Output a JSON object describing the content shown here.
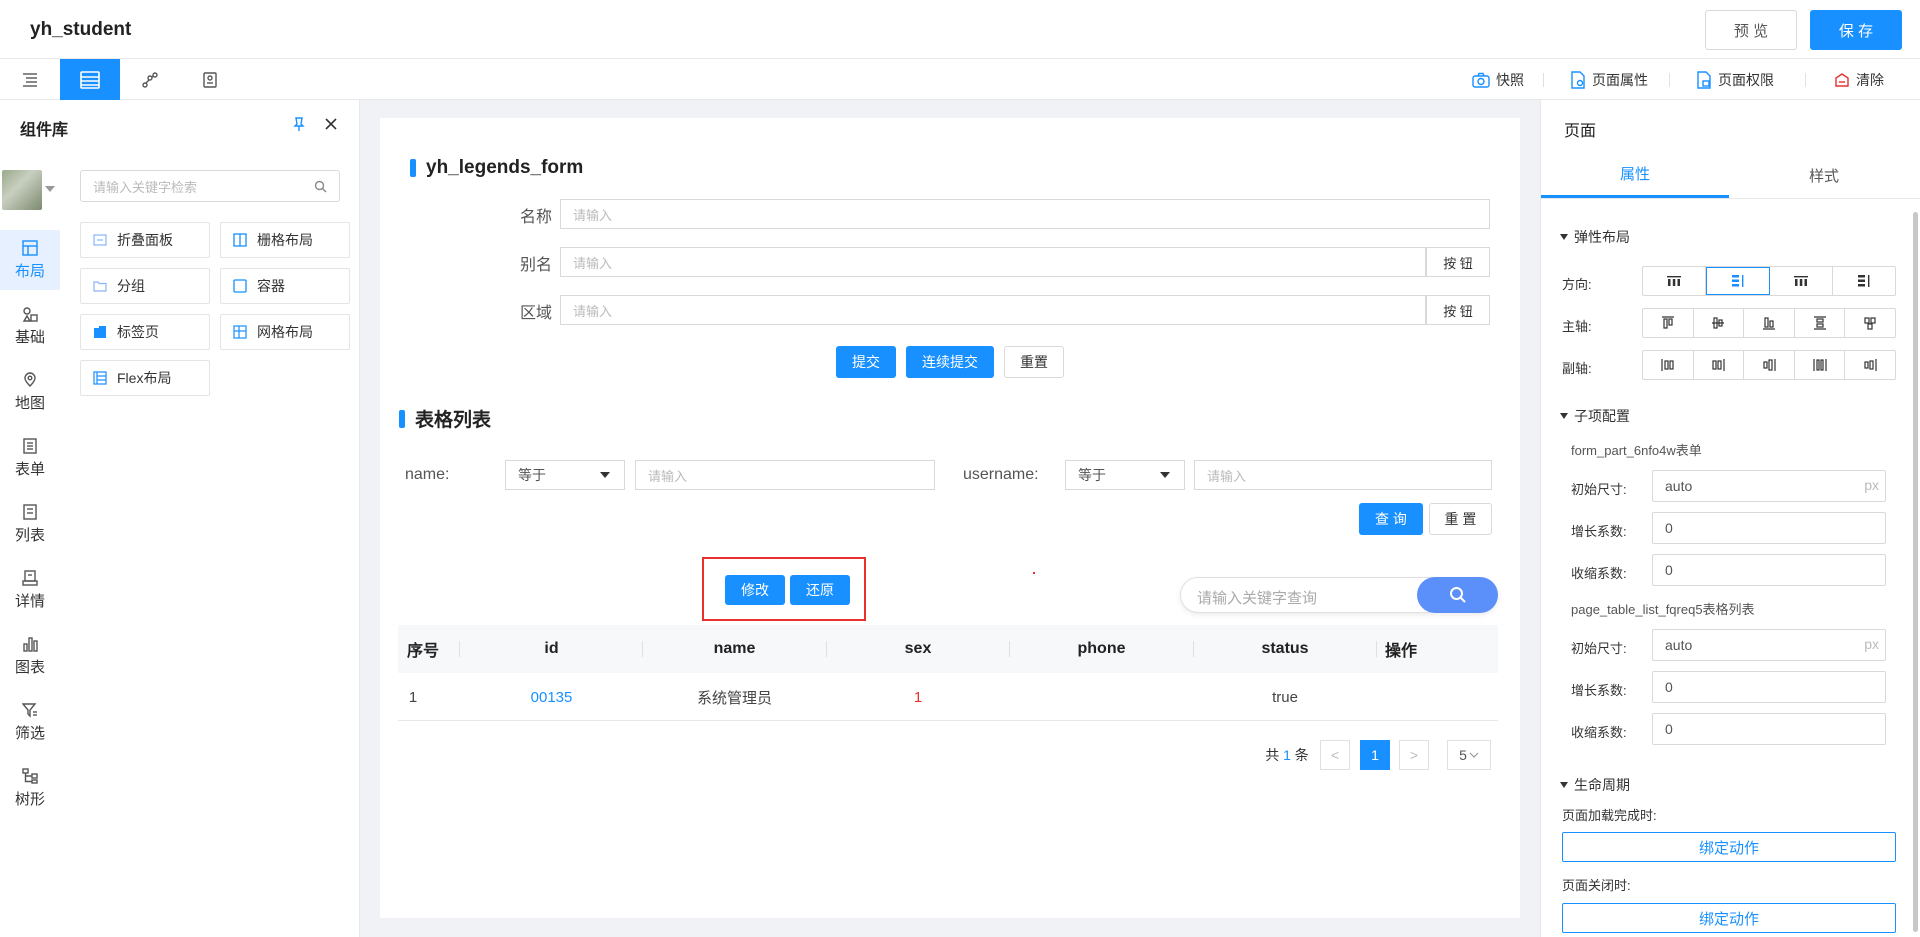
{
  "header": {
    "app_title": "yh_student",
    "preview_label": "预 览",
    "save_label": "保 存"
  },
  "toolbar": {
    "snapshot": "快照",
    "page_props": "页面属性",
    "page_perms": "页面权限",
    "clear": "清除"
  },
  "library": {
    "title": "组件库",
    "search_placeholder": "请输入关键字检索",
    "nav": [
      {
        "label": "布局"
      },
      {
        "label": "基础"
      },
      {
        "label": "地图"
      },
      {
        "label": "表单"
      },
      {
        "label": "列表"
      },
      {
        "label": "详情"
      },
      {
        "label": "图表"
      },
      {
        "label": "筛选"
      },
      {
        "label": "树形"
      }
    ],
    "components": [
      {
        "label": "折叠面板"
      },
      {
        "label": "栅格布局"
      },
      {
        "label": "分组"
      },
      {
        "label": "容器"
      },
      {
        "label": "标签页"
      },
      {
        "label": "网格布局"
      },
      {
        "label": "Flex布局"
      }
    ]
  },
  "form": {
    "title": "yh_legends_form",
    "fields": [
      {
        "label": "名称",
        "placeholder": "请输入"
      },
      {
        "label": "别名",
        "placeholder": "请输入",
        "button": "按 钮"
      },
      {
        "label": "区域",
        "placeholder": "请输入",
        "button": "按 钮"
      }
    ],
    "submit": "提交",
    "submit_continue": "连续提交",
    "reset": "重置"
  },
  "table_section": {
    "title": "表格列表",
    "filters": [
      {
        "label": "name:",
        "op": "等于",
        "placeholder": "请输入"
      },
      {
        "label": "username:",
        "op": "等于",
        "placeholder": "请输入"
      }
    ],
    "query": "查 询",
    "reset": "重 置",
    "edit": "修改",
    "restore": "还原",
    "keyword_placeholder": "请输入关键字查询",
    "columns": [
      "序号",
      "id",
      "name",
      "sex",
      "phone",
      "status",
      "操作"
    ],
    "rows": [
      {
        "index": "1",
        "id": "00135",
        "name": "系统管理员",
        "sex": "1",
        "phone": "",
        "status": "true"
      }
    ],
    "pagination": {
      "total_prefix": "共",
      "total": "1",
      "total_suffix": "条",
      "prev": "<",
      "page": "1",
      "next": ">",
      "page_size": "5"
    }
  },
  "right_panel": {
    "title": "页面",
    "tabs": [
      "属性",
      "样式"
    ],
    "flex_section": "弹性布局",
    "direction_label": "方向:",
    "main_axis_label": "主轴:",
    "cross_axis_label": "副轴:",
    "child_section": "子项配置",
    "items": [
      {
        "name": "form_part_6nfo4w表单",
        "basis_label": "初始尺寸:",
        "basis": "auto",
        "unit": "px",
        "grow_label": "增长系数:",
        "grow": "0",
        "shrink_label": "收缩系数:",
        "shrink": "0"
      },
      {
        "name": "page_table_list_fqreq5表格列表",
        "basis_label": "初始尺寸:",
        "basis": "auto",
        "unit": "px",
        "grow_label": "增长系数:",
        "grow": "0",
        "shrink_label": "收缩系数:",
        "shrink": "0"
      }
    ],
    "lifecycle_section": "生命周期",
    "on_load_label": "页面加载完成时:",
    "on_close_label": "页面关闭时:",
    "bind_action": "绑定动作"
  },
  "colors": {
    "primary": "#1890ff",
    "highlight": "#e8302d",
    "link": "#1890ff",
    "sex_value": "#e8302d"
  }
}
